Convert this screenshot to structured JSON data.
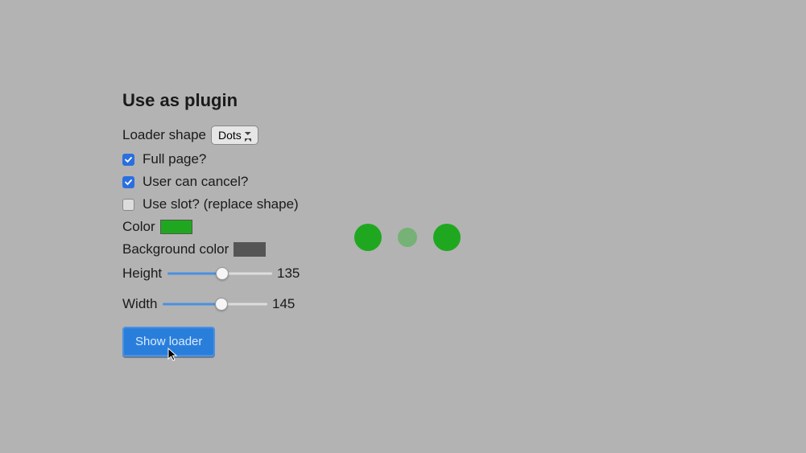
{
  "panel": {
    "title": "Use as plugin",
    "shape_label": "Loader shape",
    "shape_value": "Dots",
    "checkboxes": {
      "full_page": {
        "label": "Full page?",
        "checked": true
      },
      "can_cancel": {
        "label": "User can cancel?",
        "checked": true
      },
      "use_slot": {
        "label": "Use slot? (replace shape)",
        "checked": false
      }
    },
    "color_label": "Color",
    "color_value": "#1fa81f",
    "bg_label": "Background color",
    "bg_value": "#555555",
    "height_label": "Height",
    "height_value": "135",
    "width_label": "Width",
    "width_value": "145",
    "button_label": "Show loader"
  },
  "loader": {
    "dot_color": "#1fa81f",
    "dot_faded": "#76b176"
  }
}
